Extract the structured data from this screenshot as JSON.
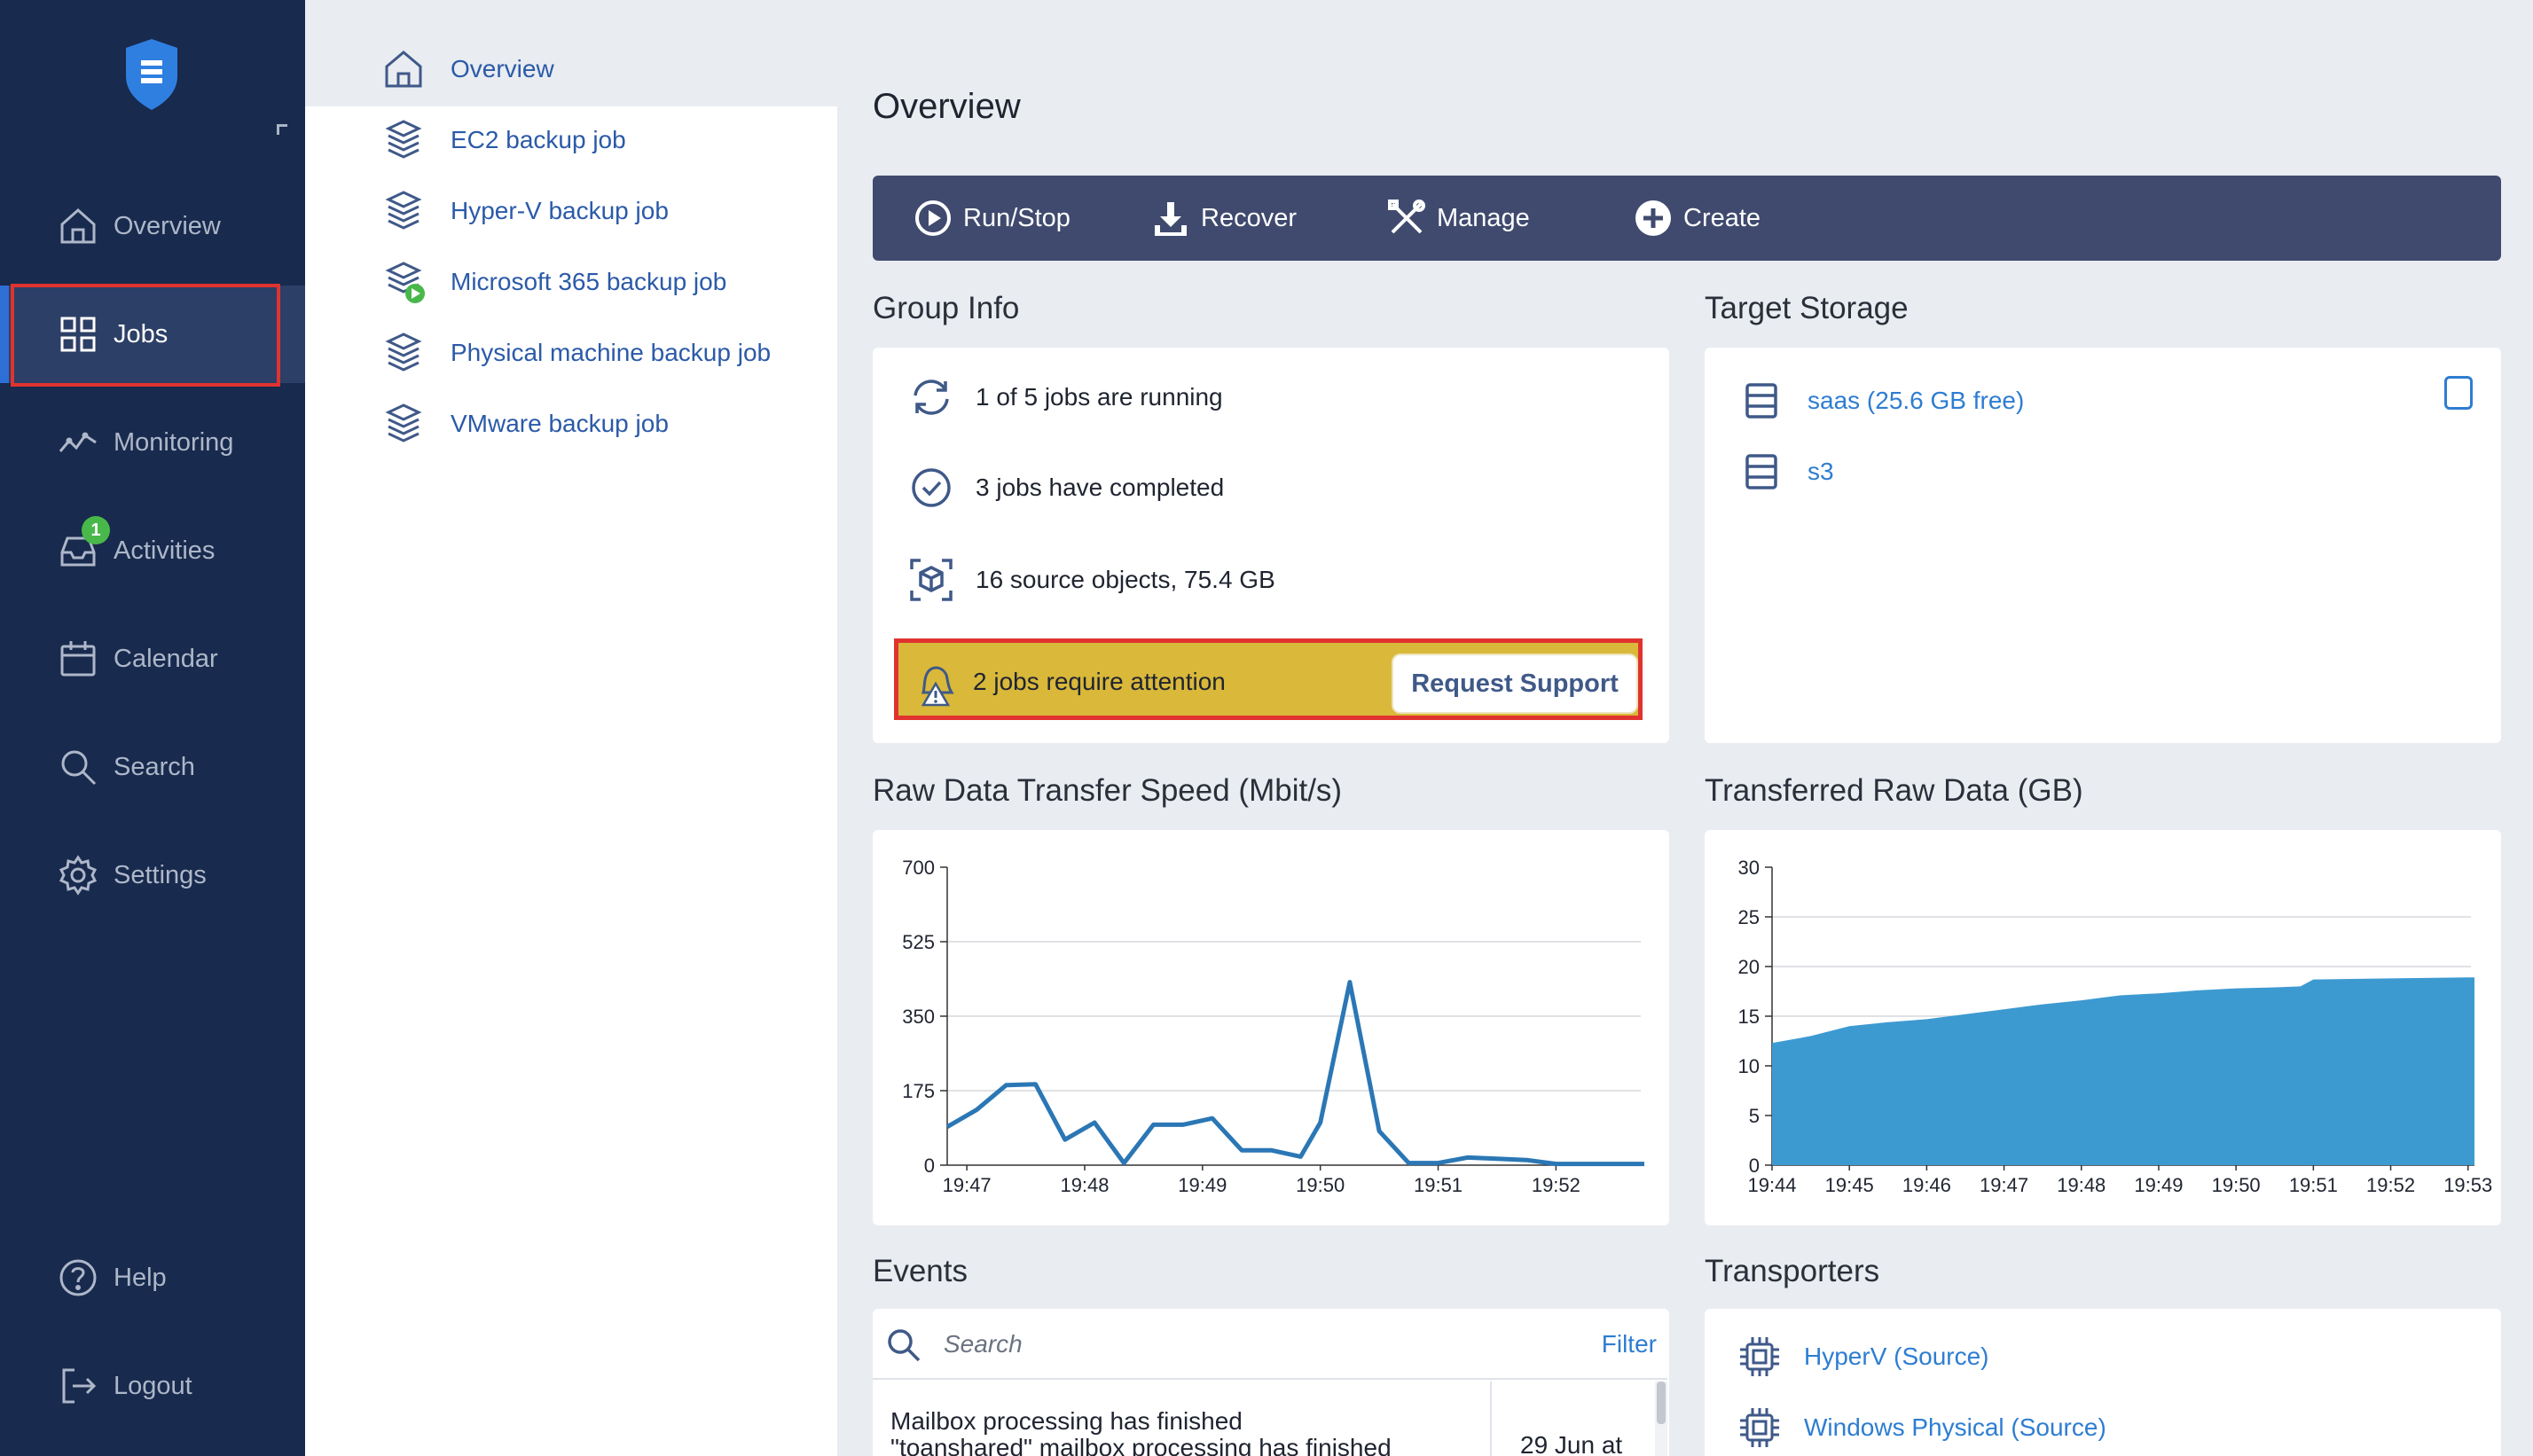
{
  "nav": {
    "items": [
      {
        "label": "Overview",
        "icon": "home-icon"
      },
      {
        "label": "Jobs",
        "icon": "grid-icon"
      },
      {
        "label": "Monitoring",
        "icon": "monitoring-icon"
      },
      {
        "label": "Activities",
        "icon": "inbox-icon",
        "badge": "1"
      },
      {
        "label": "Calendar",
        "icon": "calendar-icon"
      },
      {
        "label": "Search",
        "icon": "search-icon"
      },
      {
        "label": "Settings",
        "icon": "gear-icon"
      }
    ],
    "bottom": [
      {
        "label": "Help",
        "icon": "help-icon"
      },
      {
        "label": "Logout",
        "icon": "logout-icon"
      }
    ],
    "active_color": "#2e6fd6"
  },
  "job_list": [
    {
      "label": "Overview",
      "icon": "home-icon"
    },
    {
      "label": "EC2 backup job",
      "icon": "backup-job-icon"
    },
    {
      "label": "Hyper-V backup job",
      "icon": "backup-job-icon"
    },
    {
      "label": "Microsoft 365 backup job",
      "icon": "backup-job-running-icon"
    },
    {
      "label": "Physical machine backup job",
      "icon": "backup-job-icon"
    },
    {
      "label": "VMware backup job",
      "icon": "backup-job-icon"
    }
  ],
  "page": {
    "title": "Overview"
  },
  "toolbar": {
    "run_stop": "Run/Stop",
    "recover": "Recover",
    "manage": "Manage",
    "create": "Create"
  },
  "group_info": {
    "title": "Group Info",
    "running": "1 of 5 jobs are running",
    "completed": "3 jobs have completed",
    "source_objects": "16 source objects, 75.4 GB",
    "attention": "2 jobs require attention",
    "request_support": "Request Support",
    "attention_color": "#d9b83a"
  },
  "target_storage": {
    "title": "Target Storage",
    "items": [
      "saas (25.6 GB free)",
      "s3"
    ]
  },
  "chart_titles": {
    "speed": "Raw Data Transfer Speed (Mbit/s)",
    "transferred": "Transferred Raw Data (GB)"
  },
  "chart_data": [
    {
      "type": "line",
      "title": "Raw Data Transfer Speed (Mbit/s)",
      "ylim": [
        0,
        700
      ],
      "yticks": [
        0,
        175,
        350,
        525,
        700
      ],
      "xticks": [
        "19:47",
        "19:48",
        "19:49",
        "19:50",
        "19:51",
        "19:52"
      ],
      "x_range": [
        "19:46:50",
        "19:52:45"
      ],
      "series": [
        {
          "color": "#2b77b5",
          "x": [
            "19:46:50",
            "19:47:05",
            "19:47:20",
            "19:47:35",
            "19:47:50",
            "19:48:05",
            "19:48:20",
            "19:48:35",
            "19:48:50",
            "19:49:05",
            "19:49:20",
            "19:49:35",
            "19:49:50",
            "19:50:00",
            "19:50:15",
            "19:50:30",
            "19:50:45",
            "19:51:00",
            "19:51:15",
            "19:51:30",
            "19:51:45",
            "19:52:00",
            "19:52:15",
            "19:52:30",
            "19:52:45"
          ],
          "y": [
            90,
            130,
            188,
            190,
            60,
            100,
            5,
            95,
            95,
            110,
            35,
            35,
            20,
            100,
            430,
            80,
            5,
            5,
            18,
            15,
            12,
            3,
            3,
            3,
            3
          ]
        }
      ]
    },
    {
      "type": "area",
      "title": "Transferred Raw Data (GB)",
      "ylim": [
        0,
        30
      ],
      "yticks": [
        0,
        5,
        10,
        15,
        20,
        25,
        30
      ],
      "xticks": [
        "19:44",
        "19:45",
        "19:46",
        "19:47",
        "19:48",
        "19:49",
        "19:50",
        "19:51",
        "19:52",
        "19:53"
      ],
      "x_range": [
        "19:44",
        "19:53:05"
      ],
      "series": [
        {
          "color": "#3d9ad1",
          "x": [
            "19:44",
            "19:44:30",
            "19:45",
            "19:45:30",
            "19:46",
            "19:46:30",
            "19:47",
            "19:47:30",
            "19:48",
            "19:48:30",
            "19:49",
            "19:49:30",
            "19:50",
            "19:50:30",
            "19:50:50",
            "19:51",
            "19:52",
            "19:53",
            "19:53:05"
          ],
          "y": [
            12.3,
            13.0,
            14.0,
            14.4,
            14.7,
            15.2,
            15.7,
            16.2,
            16.6,
            17.1,
            17.3,
            17.6,
            17.8,
            17.9,
            18.0,
            18.7,
            18.8,
            18.9,
            18.9
          ]
        }
      ]
    }
  ],
  "events": {
    "title": "Events",
    "search_placeholder": "Search",
    "filter": "Filter",
    "rows": [
      {
        "line1": "Mailbox processing has finished",
        "line2": "\"toanshared\" mailbox processing has finished",
        "date": "29 Jun at"
      }
    ]
  },
  "transporters": {
    "title": "Transporters",
    "items": [
      "HyperV (Source)",
      "Windows Physical (Source)"
    ]
  }
}
